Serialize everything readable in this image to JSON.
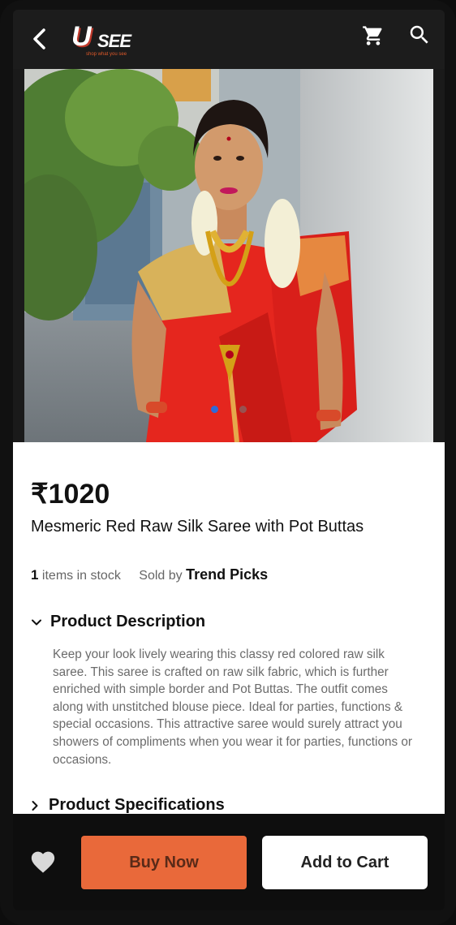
{
  "header": {
    "logo_main_u": "U",
    "logo_main_rest": "SEE",
    "logo_tagline": "shop what you see",
    "icons": [
      "back-arrow-icon",
      "cart-icon",
      "search-icon"
    ]
  },
  "product": {
    "price": "₹1020",
    "title": "Mesmeric Red Raw Silk Saree with Pot Buttas",
    "stock_count": "1",
    "stock_suffix": " items in stock",
    "sold_by_label": "Sold by ",
    "seller": "Trend Picks",
    "carousel": {
      "total": 2,
      "active_index": 0
    }
  },
  "description": {
    "heading": "Product Description",
    "expanded": true,
    "text": "Keep your look lively wearing this classy red colored raw silk saree. This saree is crafted on raw silk fabric, which is further enriched with simple border and Pot Buttas. The outfit comes along with unstitched blouse piece. Ideal for parties, functions & special occasions. This attractive saree would surely attract you showers of compliments when you wear it for parties, functions or occasions."
  },
  "specifications": {
    "heading": "Product Specifications",
    "expanded": false
  },
  "actions": {
    "buy_now": "Buy Now",
    "add_to_cart": "Add to Cart",
    "favorite_icon": "heart-icon"
  },
  "colors": {
    "accent": "#e9693a",
    "carousel_active": "#2f6ad9",
    "header_bg": "#1c1c1c"
  }
}
